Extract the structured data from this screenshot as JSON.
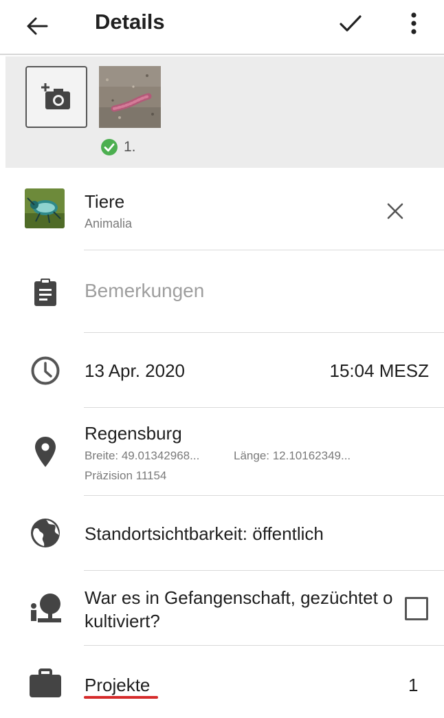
{
  "appbar": {
    "title": "Details",
    "icons": {
      "back": "arrow-back-icon",
      "save": "check-icon",
      "menu": "more-vert-icon"
    }
  },
  "photos": {
    "add_icon": "add-photo-icon",
    "items": [
      {
        "index_label": "1.",
        "status_icon": "check-circle-icon",
        "status_color": "#4caf50"
      }
    ]
  },
  "taxon": {
    "common_name": "Tiere",
    "scientific_name": "Animalia",
    "remove_icon": "close-icon"
  },
  "notes": {
    "icon": "clipboard-icon",
    "placeholder": "Bemerkungen"
  },
  "datetime": {
    "icon": "clock-icon",
    "date": "13 Apr. 2020",
    "time": "15:04 MESZ"
  },
  "location": {
    "icon": "location-pin-icon",
    "place": "Regensburg",
    "latitude": "Breite: 49.01342968...",
    "longitude": "Länge: 12.10162349...",
    "accuracy": "Präzision 11154"
  },
  "geoprivacy": {
    "icon": "globe-icon",
    "label": "Standortsichtbarkeit: öffentlich"
  },
  "captive": {
    "icon": "captive-tree-icon",
    "label_line1": "War es in Gefangenschaft, gezüchtet o",
    "label_line2": "kultiviert?",
    "checked": false
  },
  "projects": {
    "icon": "briefcase-icon",
    "label": "Projekte",
    "count": "1",
    "underline_color": "#d62b2b"
  }
}
